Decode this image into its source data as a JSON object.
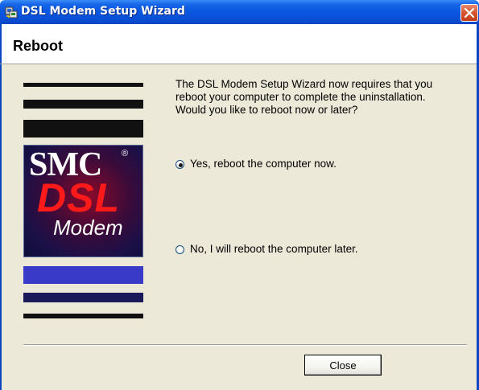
{
  "window": {
    "title": "DSL Modem Setup Wizard",
    "close_icon": "close-icon",
    "app_icon": "setup-wizard-icon"
  },
  "header": {
    "title": "Reboot"
  },
  "logo": {
    "brand": "SMC",
    "registered": "®",
    "product_line1": "DSL",
    "product_line2": "Modem"
  },
  "main": {
    "instructions": "The DSL Modem Setup Wizard now requires that you reboot your computer to complete the uninstallation.  Would you like to reboot now or later?",
    "options": [
      {
        "label": "Yes, reboot the computer now.",
        "selected": true
      },
      {
        "label": "No, I will reboot the computer later.",
        "selected": false
      }
    ]
  },
  "footer": {
    "close_label": "Close"
  },
  "colors": {
    "titlebar": "#0a56e0",
    "dialog_bg": "#ece9d8",
    "close_button": "#d6552f",
    "logo_dsl": "#ff1a1a",
    "stripe_blue": "#3a3ac8",
    "stripe_navy": "#1a1a5a"
  }
}
